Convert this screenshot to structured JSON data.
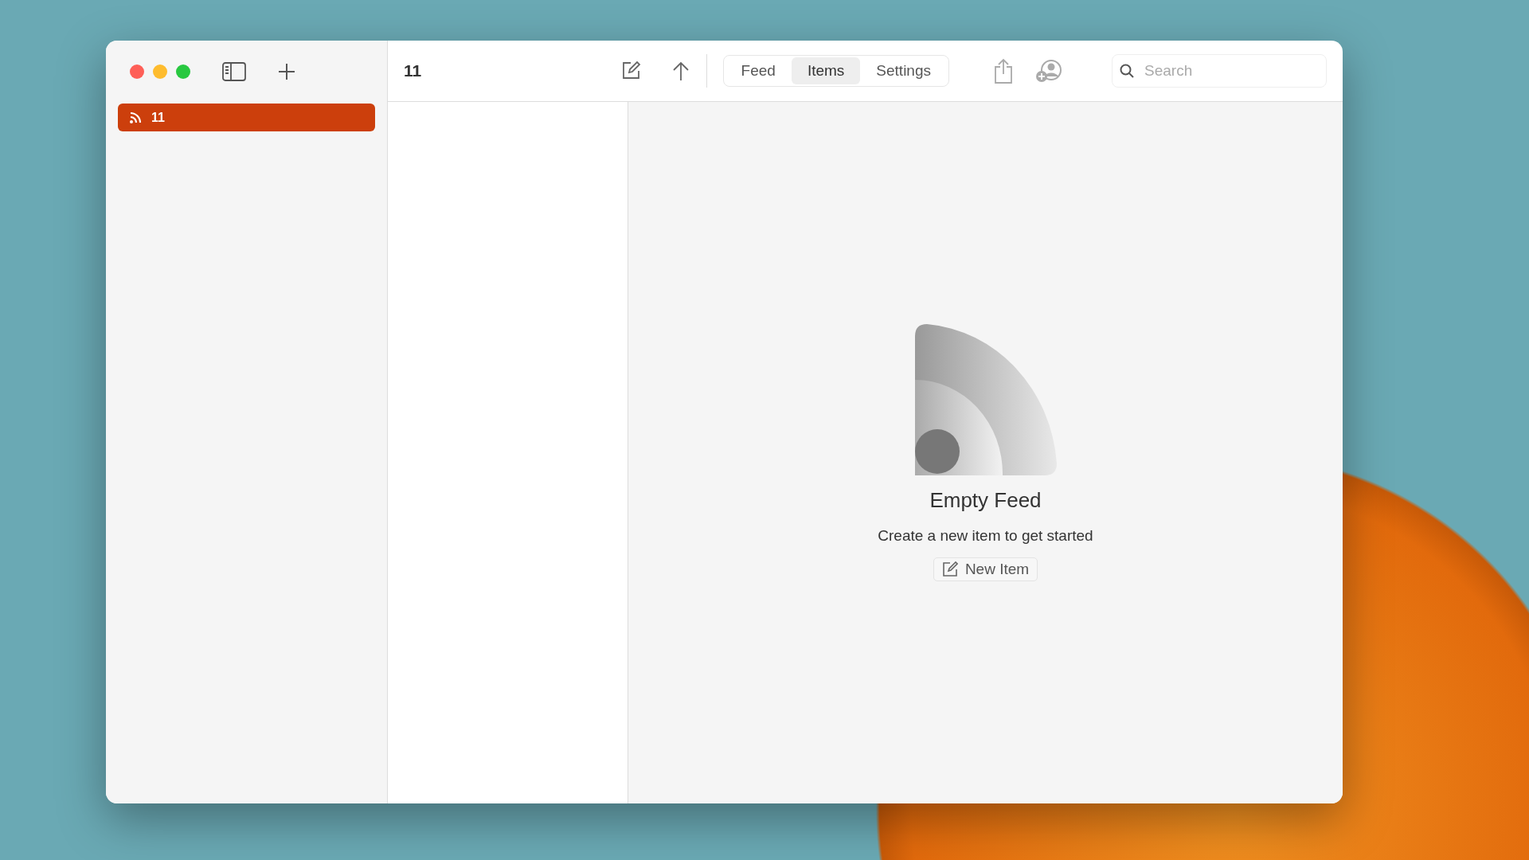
{
  "sidebar": {
    "items": [
      {
        "label": "11",
        "selected": true
      }
    ]
  },
  "toolbar": {
    "title": "11",
    "tabs": [
      {
        "label": "Feed",
        "selected": false
      },
      {
        "label": "Items",
        "selected": true
      },
      {
        "label": "Settings",
        "selected": false
      }
    ],
    "search": {
      "placeholder": "Search"
    }
  },
  "empty_state": {
    "title": "Empty Feed",
    "message": "Create a new item to get started",
    "button": "New Item"
  }
}
